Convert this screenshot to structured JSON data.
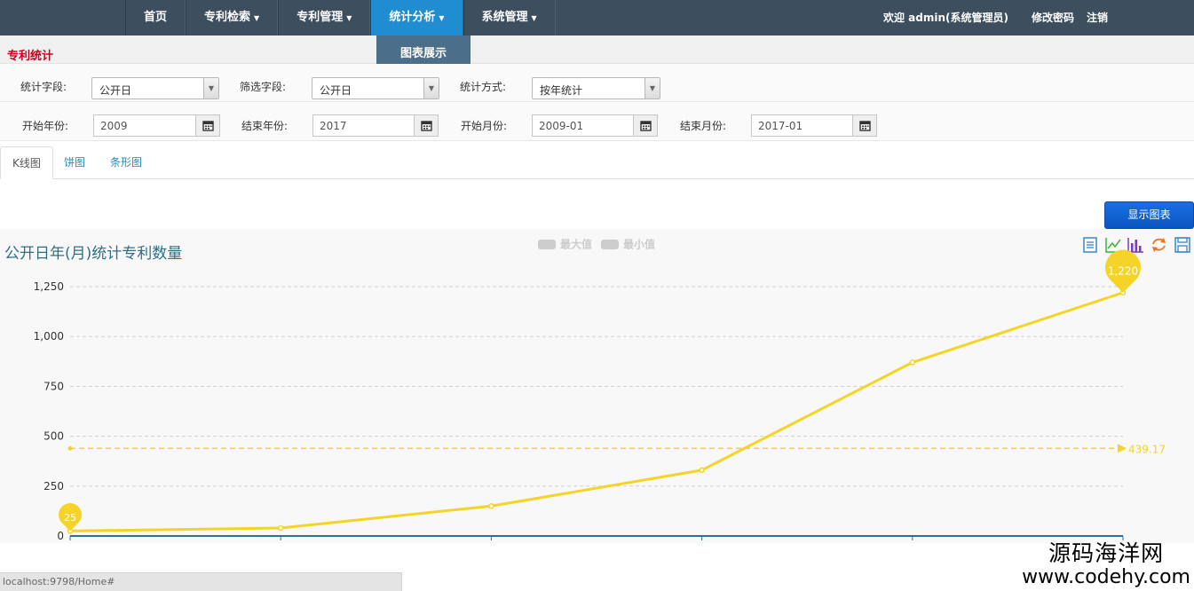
{
  "nav": {
    "items": [
      {
        "label": "首页",
        "caret": false,
        "active": false
      },
      {
        "label": "专利检索",
        "caret": true,
        "active": false
      },
      {
        "label": "专利管理",
        "caret": true,
        "active": false
      },
      {
        "label": "统计分析",
        "caret": true,
        "active": true
      },
      {
        "label": "系统管理",
        "caret": true,
        "active": false
      }
    ],
    "welcome": "欢迎 admin(系统管理员)",
    "change_password": "修改密码",
    "logout": "注销",
    "dropdown_item": "图表展示"
  },
  "section_title": "专利统计",
  "filters": {
    "stat_field_label": "统计字段:",
    "stat_field_value": "公开日",
    "filter_field_label": "筛选字段:",
    "filter_field_value": "公开日",
    "stat_method_label": "统计方式:",
    "stat_method_value": "按年统计",
    "start_year_label": "开始年份:",
    "start_year_value": "2009",
    "end_year_label": "结束年份:",
    "end_year_value": "2017",
    "start_month_label": "开始月份:",
    "start_month_value": "2009-01",
    "end_month_label": "结束月份:",
    "end_month_value": "2017-01"
  },
  "tabs": [
    {
      "label": "K线图",
      "active": true
    },
    {
      "label": "饼图",
      "active": false
    },
    {
      "label": "条形图",
      "active": false
    }
  ],
  "show_chart_button": "显示图表",
  "chart_title": "公开日年(月)统计专利数量",
  "legend": {
    "max": "最大值",
    "min": "最小值"
  },
  "toolbox_icons": [
    "data-view-icon",
    "line-chart-icon",
    "bar-chart-icon",
    "refresh-icon",
    "save-icon"
  ],
  "chart_data": {
    "type": "line",
    "ylim": [
      0,
      1250
    ],
    "y_ticks": [
      "0",
      "250",
      "500",
      "750",
      "1,000",
      "1,250"
    ],
    "values": [
      25,
      40,
      150,
      330,
      870,
      1220
    ],
    "max_label": "1,220",
    "min_label": "25",
    "average": 439.17,
    "average_label": "439.17",
    "line_color": "#f5d327",
    "grid": true
  },
  "status_url": "localhost:9798/Home#",
  "watermark": {
    "line1": "源码海洋网",
    "line2": "www.codehy.com"
  }
}
